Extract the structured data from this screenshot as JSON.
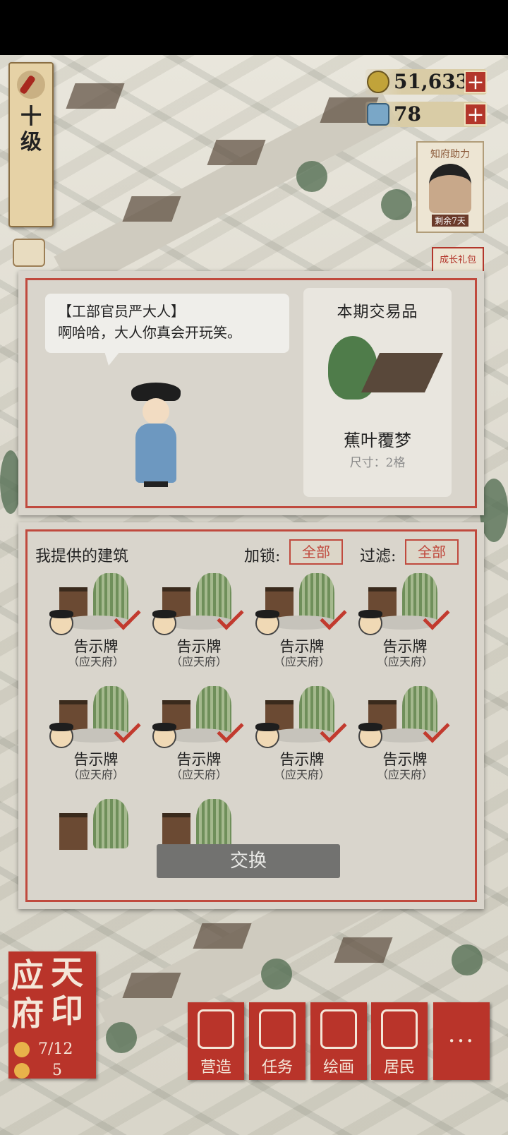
{
  "hud": {
    "level": "十级",
    "coins": "51,633",
    "tickets": "78",
    "plus": "+",
    "helper_title": "知府助力",
    "helper_badge": "剩余7天",
    "gift": "成长礼包"
  },
  "dialog": {
    "speaker": "【工部官员严大人】",
    "line": "啊哈哈，大人你真会开玩笑。"
  },
  "trade_item": {
    "header": "本期交易品",
    "name": "蕉叶覆梦",
    "size": "尺寸：2格"
  },
  "offer_panel": {
    "title": "我提供的建筑",
    "lock_label": "加锁:",
    "lock_value": "全部",
    "filter_label": "过滤:",
    "filter_value": "全部",
    "items": [
      {
        "name": "告示牌",
        "sub": "（应天府）"
      },
      {
        "name": "告示牌",
        "sub": "（应天府）"
      },
      {
        "name": "告示牌",
        "sub": "（应天府）"
      },
      {
        "name": "告示牌",
        "sub": "（应天府）"
      },
      {
        "name": "告示牌",
        "sub": "（应天府）"
      },
      {
        "name": "告示牌",
        "sub": "（应天府）"
      },
      {
        "name": "告示牌",
        "sub": "（应天府）"
      },
      {
        "name": "告示牌",
        "sub": "（应天府）"
      }
    ],
    "exchange_button": "交换"
  },
  "seal": {
    "chars": [
      "应",
      "天",
      "府",
      "印"
    ],
    "population": "7/12",
    "idle": "5"
  },
  "menu": [
    {
      "label": "营造",
      "icon": "pavilion-icon"
    },
    {
      "label": "任务",
      "icon": "book-icon"
    },
    {
      "label": "绘画",
      "icon": "scroll-icon"
    },
    {
      "label": "居民",
      "icon": "resident-icon"
    },
    {
      "label": "···",
      "icon": "more-icon"
    }
  ],
  "colors": {
    "accent": "#c04a3e",
    "panel": "#d9d5cc",
    "seal": "#b9342a"
  }
}
